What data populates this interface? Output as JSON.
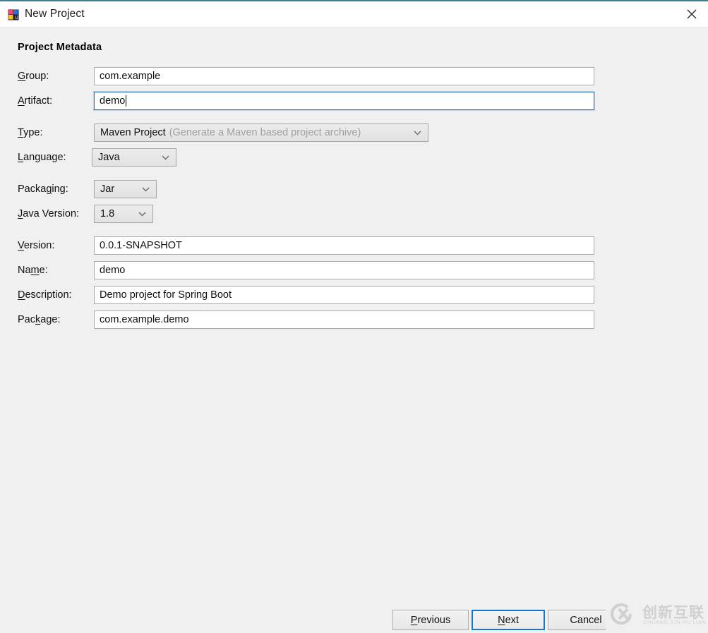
{
  "window": {
    "title": "New Project",
    "app_icon": "intellij-idea-icon",
    "close_icon": "close-icon",
    "accent_top_border": "#3d7f8e",
    "titlebar_bg": "#ffffff",
    "body_bg": "#f0f0f0"
  },
  "section": {
    "heading": "Project Metadata"
  },
  "fields": {
    "group": {
      "label_pre": "",
      "label_mnemonic": "G",
      "label_post": "roup:",
      "value": "com.example",
      "focused": false
    },
    "artifact": {
      "label_pre": "",
      "label_mnemonic": "A",
      "label_post": "rtifact:",
      "value": "demo",
      "focused": true
    },
    "type": {
      "label_pre": "",
      "label_mnemonic": "T",
      "label_post": "ype:",
      "value": "Maven Project",
      "hint": "(Generate a Maven based project archive)",
      "chevron_icon": "chevron-down-icon"
    },
    "language": {
      "label_pre": "",
      "label_mnemonic": "L",
      "label_post": "anguage:",
      "value": "Java",
      "chevron_icon": "chevron-down-icon"
    },
    "packaging": {
      "label_pre": "Packa",
      "label_mnemonic": "g",
      "label_post": "ing:",
      "value": "Jar",
      "chevron_icon": "chevron-down-icon"
    },
    "java_version": {
      "label_pre": "",
      "label_mnemonic": "J",
      "label_post": "ava Version:",
      "value": "1.8",
      "chevron_icon": "chevron-down-icon"
    },
    "version": {
      "label_pre": "",
      "label_mnemonic": "V",
      "label_post": "ersion:",
      "value": "0.0.1-SNAPSHOT",
      "focused": false
    },
    "name": {
      "label_pre": "Na",
      "label_mnemonic": "m",
      "label_post": "e:",
      "value": "demo",
      "focused": false
    },
    "description": {
      "label_pre": "",
      "label_mnemonic": "D",
      "label_post": "escription:",
      "value": "Demo project for Spring Boot",
      "focused": false
    },
    "package": {
      "label_pre": "Pac",
      "label_mnemonic": "k",
      "label_post": "age:",
      "value": "com.example.demo",
      "focused": false
    }
  },
  "buttons": {
    "previous": {
      "pre": "",
      "mnemonic": "P",
      "post": "revious",
      "default": false
    },
    "next": {
      "pre": "",
      "mnemonic": "N",
      "post": "ext",
      "default": true
    },
    "cancel": {
      "pre": "Cancel",
      "mnemonic": "",
      "post": "",
      "default": false
    }
  },
  "watermark": {
    "logo_icon": "cx-logo-icon",
    "chinese": "创新互联",
    "pinyin": "CHUANG XIN HU LIAN"
  }
}
